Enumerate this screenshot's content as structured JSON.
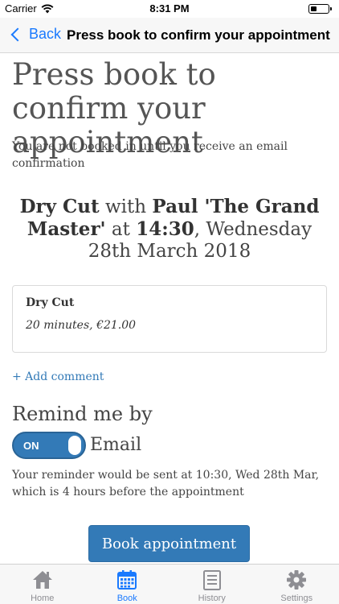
{
  "status_bar": {
    "carrier": "Carrier",
    "time": "8:31 PM"
  },
  "nav": {
    "back_label": "Back",
    "title": "Press book to confirm your appointment"
  },
  "main": {
    "title": "Press book to confirm your appointment",
    "notice": "You are not booked in until you receive an email confirmation",
    "summary": {
      "service": "Dry Cut",
      "with": "with",
      "staff": "Paul 'The Grand Master'",
      "at": "at",
      "time": "14:30",
      "date": ", Wednesday 28th March 2018"
    },
    "service_card": {
      "name": "Dry Cut",
      "detail": "20 minutes, €21.00"
    },
    "add_comment": "+ Add comment",
    "remind": {
      "title": "Remind me by",
      "toggle_state": "ON",
      "method": "Email",
      "info": "Your reminder would be sent at 10:30, Wed 28th Mar, which is 4 hours before the appointment"
    },
    "book_button": "Book appointment"
  },
  "tabs": [
    {
      "label": "Home",
      "icon": "home-icon"
    },
    {
      "label": "Book",
      "icon": "calendar-icon",
      "active": true
    },
    {
      "label": "History",
      "icon": "list-icon"
    },
    {
      "label": "Settings",
      "icon": "gear-icon"
    }
  ],
  "colors": {
    "accent": "#1a7afe",
    "primary_button": "#337ab7",
    "link": "#337ab7"
  }
}
